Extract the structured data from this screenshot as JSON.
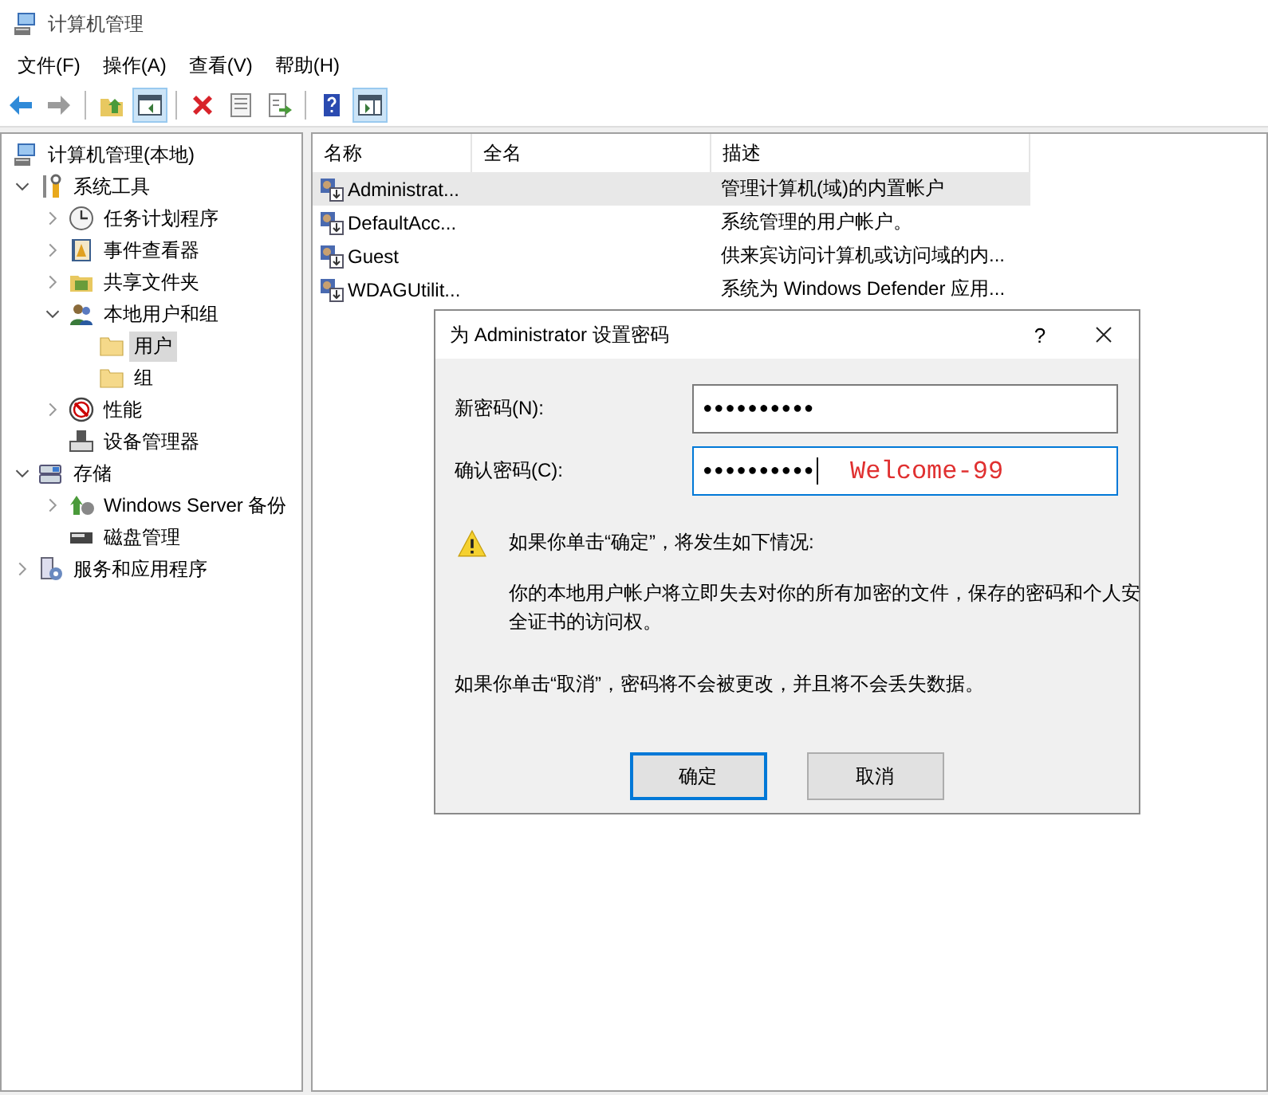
{
  "window": {
    "title": "计算机管理"
  },
  "menu": [
    {
      "label": "文件(F)"
    },
    {
      "label": "操作(A)"
    },
    {
      "label": "查看(V)"
    },
    {
      "label": "帮助(H)"
    }
  ],
  "toolbar": [
    {
      "kind": "back",
      "disabled": false,
      "pressed": false
    },
    {
      "kind": "forward",
      "disabled": true,
      "pressed": false
    },
    {
      "kind": "separator"
    },
    {
      "kind": "up",
      "disabled": false,
      "pressed": false
    },
    {
      "kind": "tree",
      "disabled": false,
      "pressed": true
    },
    {
      "kind": "separator"
    },
    {
      "kind": "delete",
      "disabled": false,
      "pressed": false
    },
    {
      "kind": "properties",
      "disabled": false,
      "pressed": false
    },
    {
      "kind": "export",
      "disabled": false,
      "pressed": false
    },
    {
      "kind": "separator"
    },
    {
      "kind": "help",
      "disabled": false,
      "pressed": false
    },
    {
      "kind": "action-pane",
      "disabled": false,
      "pressed": true
    }
  ],
  "tree": [
    {
      "label": "计算机管理(本地)",
      "kind": "computer",
      "selected": false,
      "children": [
        {
          "label": "系统工具",
          "kind": "tools",
          "expanded": true,
          "selected": false,
          "children": [
            {
              "label": "任务计划程序",
              "kind": "clock",
              "expanded": false,
              "selected": false
            },
            {
              "label": "事件查看器",
              "kind": "log",
              "expanded": false,
              "selected": false
            },
            {
              "label": "共享文件夹",
              "kind": "share",
              "expanded": false,
              "selected": false
            },
            {
              "label": "本地用户和组",
              "kind": "users",
              "expanded": true,
              "selected": false,
              "children": [
                {
                  "label": "用户",
                  "kind": "folder",
                  "selected": true
                },
                {
                  "label": "组",
                  "kind": "folder",
                  "selected": false
                }
              ]
            },
            {
              "label": "性能",
              "kind": "performance",
              "expanded": false,
              "selected": false
            },
            {
              "label": "设备管理器",
              "kind": "device",
              "selected": false
            }
          ]
        },
        {
          "label": "存储",
          "kind": "storage",
          "expanded": true,
          "selected": false,
          "children": [
            {
              "label": "Windows Server 备份",
              "kind": "backup",
              "expanded": false,
              "selected": false
            },
            {
              "label": "磁盘管理",
              "kind": "disk",
              "selected": false
            }
          ]
        },
        {
          "label": "服务和应用程序",
          "kind": "services",
          "expanded": false,
          "selected": false
        }
      ]
    }
  ],
  "table": {
    "columns": [
      "名称",
      "全名",
      "描述"
    ],
    "rows": [
      {
        "name": "Administrat...",
        "description": "管理计算机(域)的内置帐户",
        "selected": true
      },
      {
        "name": "DefaultAcc...",
        "description": "系统管理的用户帐户。",
        "selected": false
      },
      {
        "name": "Guest",
        "description": "供来宾访问计算机或访问域的内...",
        "selected": false
      },
      {
        "name": "WDAGUtilit...",
        "description": "系统为 Windows Defender 应用...",
        "selected": false
      }
    ]
  },
  "dialog": {
    "title": "为 Administrator 设置密码",
    "help_label": "?",
    "fields": [
      {
        "label": "新密码(N):",
        "value": "●●●●●●●●●●",
        "focused": false
      },
      {
        "label": "确认密码(C):",
        "value": "●●●●●●●●●●",
        "focused": true,
        "annotation": "Welcome-99"
      }
    ],
    "warning_title": "如果你单击“确定”，将发生如下情况:",
    "warning_body": "你的本地用户帐户将立即失去对你的所有加密的文件，保存的密码和个人安全证书的访问权。",
    "cancel_note": "如果你单击“取消”，密码将不会被更改，并且将不会丢失数据。",
    "buttons": [
      {
        "label": "确定",
        "default": true
      },
      {
        "label": "取消",
        "default": false
      }
    ]
  }
}
